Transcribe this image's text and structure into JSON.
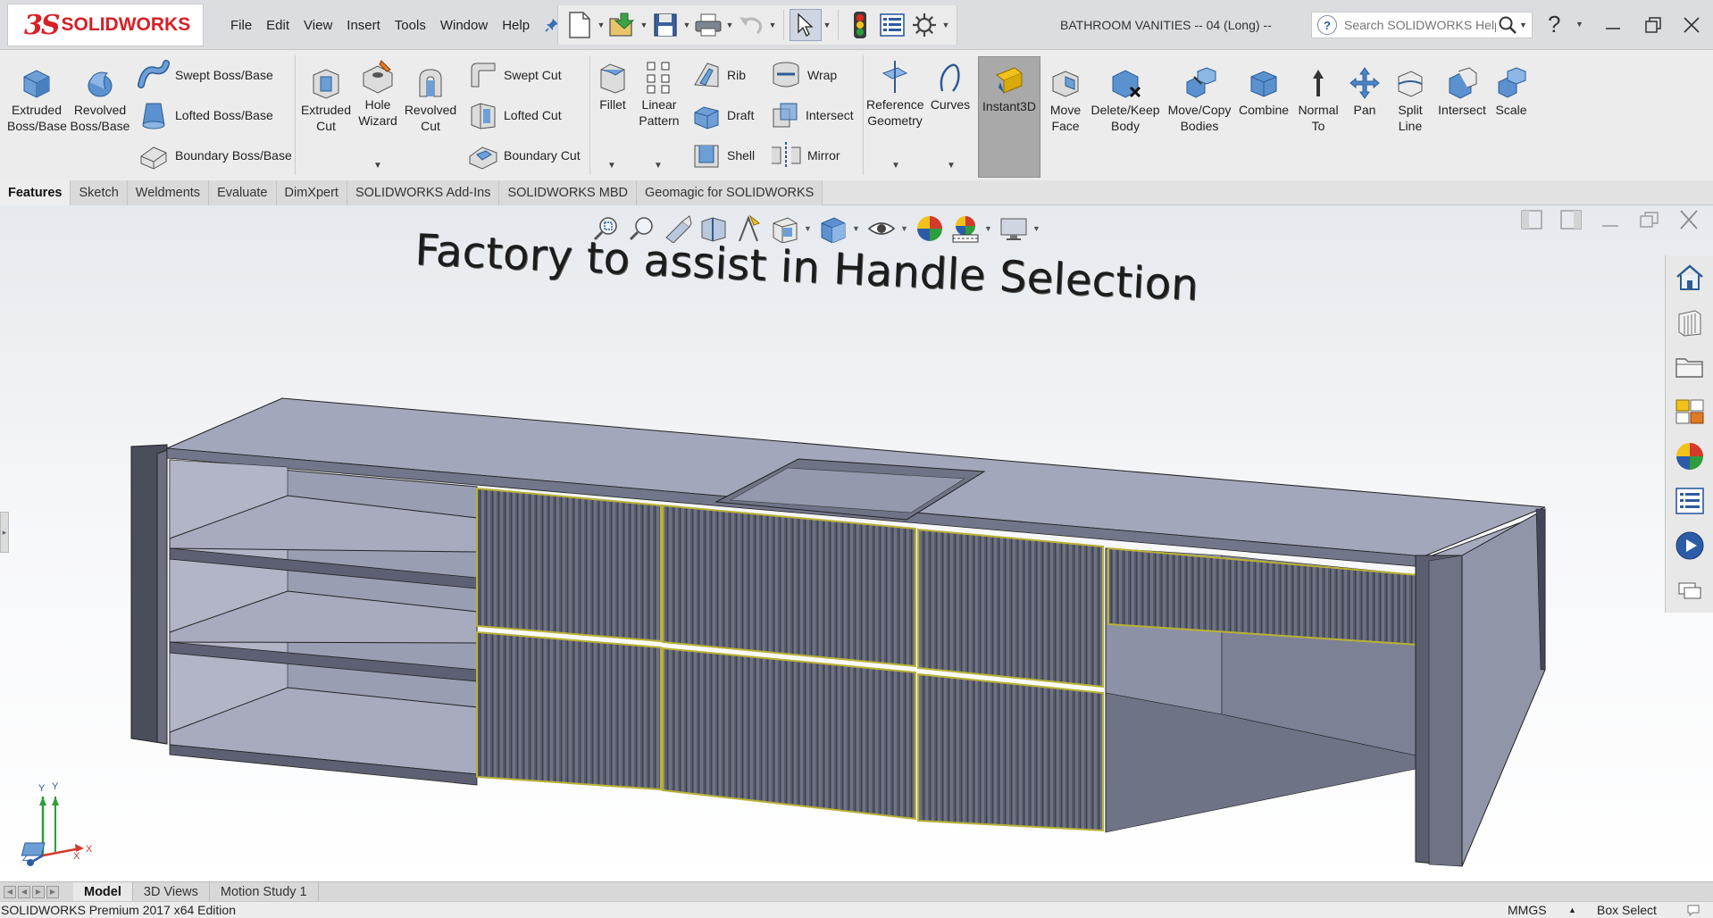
{
  "app": {
    "logo_mark": "3S",
    "logo_name": "SOLIDWORKS",
    "document_title": "BATHROOM VANITIES -- 04 (Long) --"
  },
  "menus": [
    "File",
    "Edit",
    "View",
    "Insert",
    "Tools",
    "Window",
    "Help"
  ],
  "quick_access": {
    "icons": [
      "new-document-icon",
      "open-icon",
      "save-icon",
      "print-icon",
      "undo-icon",
      "select-icon",
      "rebuild-icon",
      "file-properties-icon",
      "options-icon"
    ]
  },
  "help_search": {
    "placeholder": "Search SOLIDWORKS Help"
  },
  "ribbon": {
    "extruded_boss": "Extruded\nBoss/Base",
    "revolved_boss": "Revolved\nBoss/Base",
    "swept_boss": "Swept Boss/Base",
    "lofted_boss": "Lofted Boss/Base",
    "boundary_boss": "Boundary Boss/Base",
    "extruded_cut": "Extruded\nCut",
    "hole_wizard": "Hole\nWizard",
    "revolved_cut": "Revolved\nCut",
    "swept_cut": "Swept Cut",
    "lofted_cut": "Lofted Cut",
    "boundary_cut": "Boundary Cut",
    "fillet": "Fillet",
    "linear_pattern": "Linear\nPattern",
    "rib": "Rib",
    "draft": "Draft",
    "shell": "Shell",
    "wrap": "Wrap",
    "intersect_1": "Intersect",
    "mirror": "Mirror",
    "reference_geometry": "Reference\nGeometry",
    "curves": "Curves",
    "instant3d": "Instant3D",
    "move_face": "Move\nFace",
    "delete_keep_body": "Delete/Keep\nBody",
    "move_copy_bodies": "Move/Copy\nBodies",
    "combine": "Combine",
    "normal_to": "Normal\nTo",
    "pan": "Pan",
    "split_line": "Split\nLine",
    "intersect_2": "Intersect",
    "scale": "Scale"
  },
  "tabs": [
    "Features",
    "Sketch",
    "Weldments",
    "Evaluate",
    "DimXpert",
    "SOLIDWORKS Add-Ins",
    "SOLIDWORKS MBD",
    "Geomagic for SOLIDWORKS"
  ],
  "active_tab": "Features",
  "viewport": {
    "annotation": "Factory to assist in Handle Selection",
    "triad_labels": {
      "y1": "Y",
      "y2": "Y",
      "x": "X",
      "x2": "X",
      "z": "Z"
    }
  },
  "bottom_tabs": [
    "Model",
    "3D Views",
    "Motion Study 1"
  ],
  "status": {
    "edition": "SOLIDWORKS Premium 2017 x64 Edition",
    "units": "MMGS",
    "mode": "Box Select"
  },
  "colors": {
    "brand": "#d71f26",
    "model_face_light": "#a3a7bb",
    "model_face_dark": "#5b5e6e",
    "selection_edge": "#c9c23a"
  }
}
